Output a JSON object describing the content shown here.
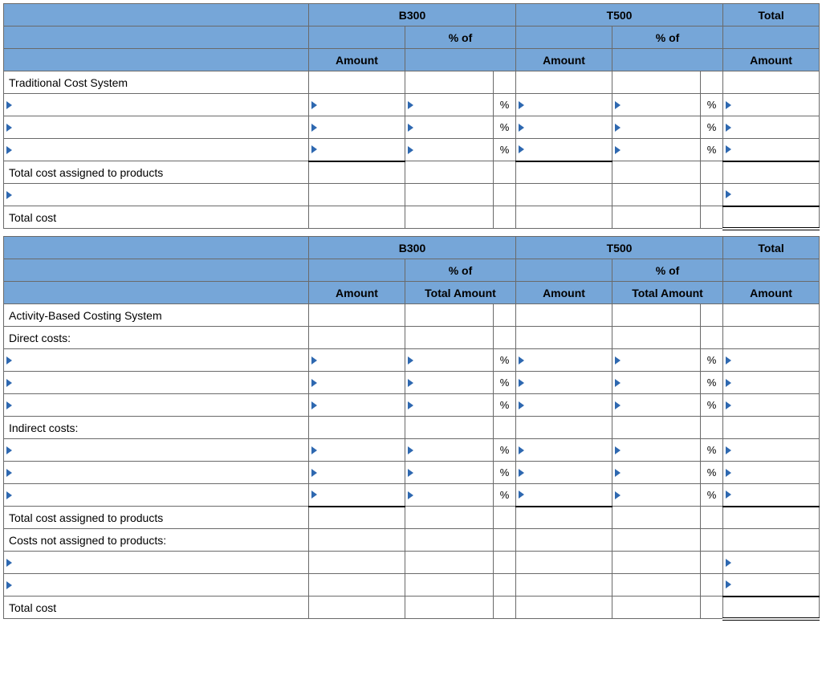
{
  "columns": {
    "b300": "B300",
    "t500": "T500",
    "total": "Total",
    "amount": "Amount",
    "pct_of": "% of",
    "pct_of_total": "Total Amount",
    "pct_sign": "%"
  },
  "sections": {
    "traditional": {
      "title": "Traditional Cost System",
      "total_assigned": "Total cost assigned to products",
      "total_cost": "Total cost"
    },
    "abc": {
      "title": "Activity-Based Costing System",
      "direct": "Direct costs:",
      "indirect": "Indirect costs:",
      "total_assigned": "Total cost assigned to products",
      "not_assigned": "Costs not assigned to products:",
      "total_cost": "Total cost"
    }
  }
}
